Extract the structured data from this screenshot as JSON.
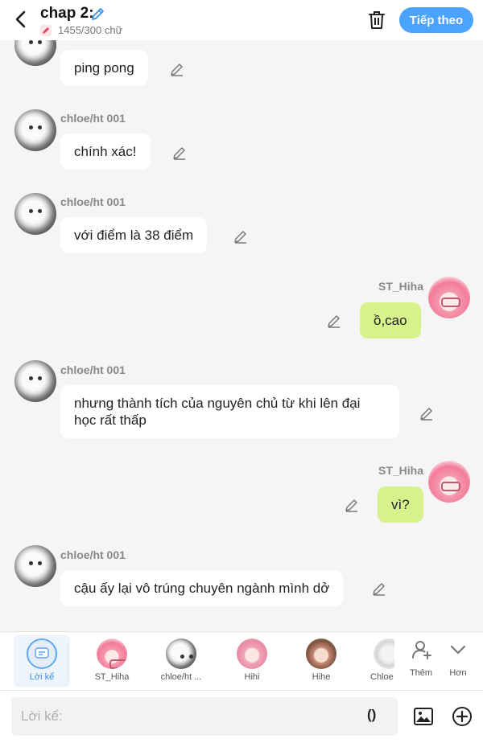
{
  "header": {
    "title": "chap 2:",
    "word_count": "1455/300 chữ",
    "next_label": "Tiếp theo"
  },
  "messages": [
    {
      "sender": "",
      "text": "ping pong",
      "mine": false
    },
    {
      "sender": "chloe/ht 001",
      "text": "chính xác!",
      "mine": false
    },
    {
      "sender": "chloe/ht 001",
      "text": "với điểm là 38 điểm",
      "mine": false
    },
    {
      "sender": "ST_Hiha",
      "text": "ồ,cao",
      "mine": true
    },
    {
      "sender": "chloe/ht 001",
      "text_line1": "nhưng thành tích của nguyên chủ từ khi lên đại",
      "text_line2": "học rất thấp",
      "mine": false
    },
    {
      "sender": "ST_Hiha",
      "text": "vì?",
      "mine": true
    },
    {
      "sender": "chloe/ht 001",
      "text": "cậu ấy lại vô trúng chuyên ngành mình dở",
      "mine": false
    }
  ],
  "characters": [
    {
      "label": "Lời kể",
      "active": true
    },
    {
      "label": "ST_Hiha"
    },
    {
      "label": "chloe/ht ..."
    },
    {
      "label": "Hihi"
    },
    {
      "label": "Hihe"
    },
    {
      "label": "Chloe"
    }
  ],
  "tools": {
    "add_label": "Thêm",
    "more_label": "Hơn"
  },
  "input": {
    "placeholder": "Lời kể:",
    "paren_label": "()"
  },
  "colors": {
    "accent": "#4aa3ff",
    "my_bubble": "#d7f18c",
    "background": "#f5f5f5"
  }
}
